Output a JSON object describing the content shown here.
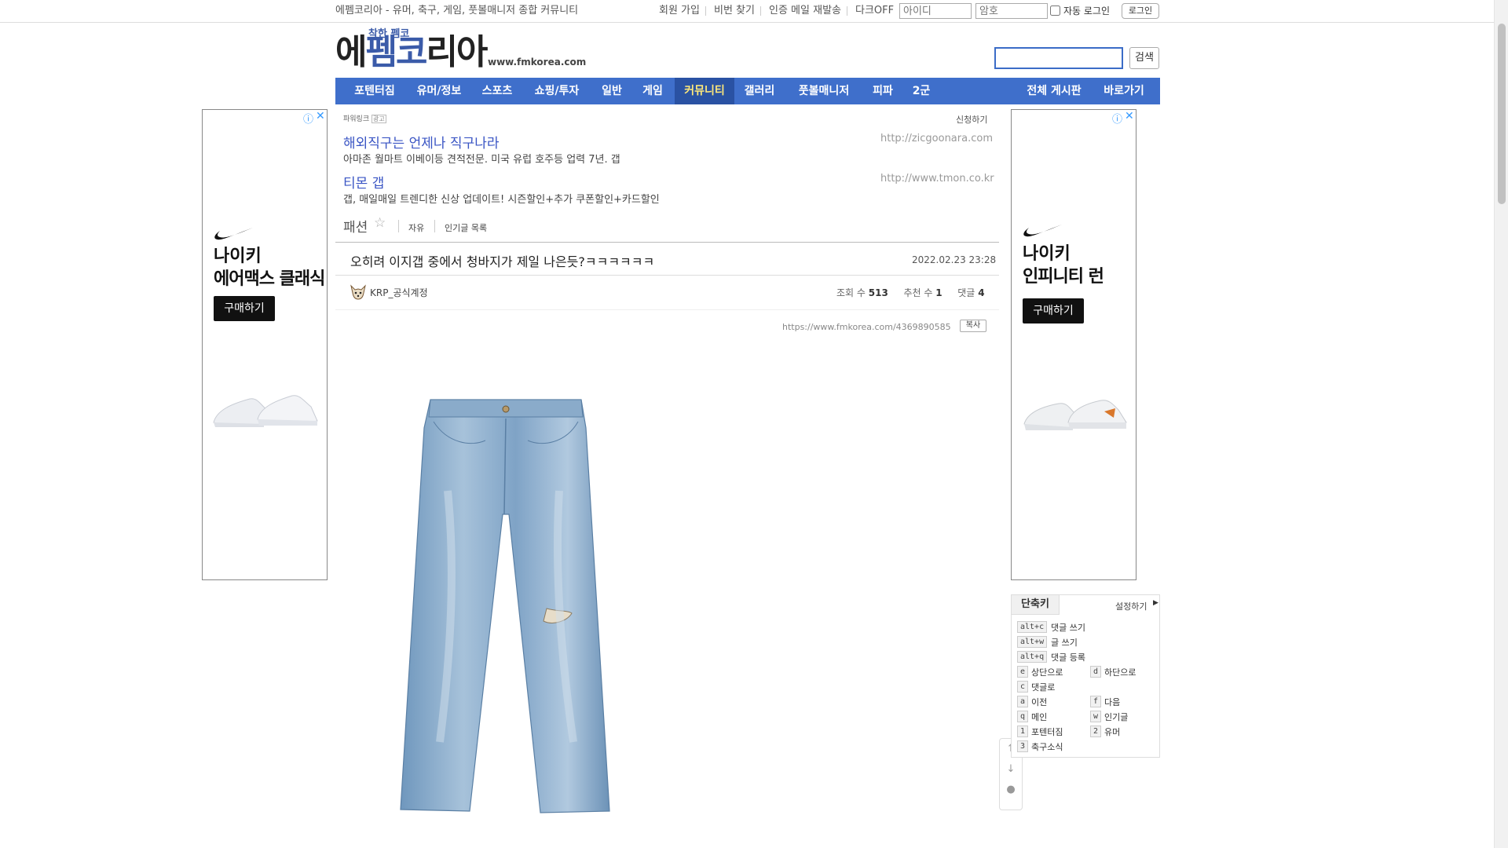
{
  "topbar": {
    "site_desc": "에펨코리아 - 유머, 축구, 게임, 풋볼매니저 종합 커뮤니티",
    "links": [
      "회원 가입",
      "비번 찾기",
      "인증 메일 재발송",
      "다크OFF"
    ],
    "id_placeholder": "아이디",
    "pw_placeholder": "암호",
    "auto_login": "자동 로그인",
    "login": "로그인"
  },
  "logo": {
    "tagline": "착한 펨코",
    "main_left": "에",
    "main_blue": "펨코",
    "main_right": "리아",
    "url": "www.fmkorea.com"
  },
  "search": {
    "button": "검색"
  },
  "nav": {
    "items": [
      "포텐터짐",
      "유머/정보",
      "스포츠",
      "쇼핑/투자",
      "일반",
      "게임",
      "커뮤니티",
      "갤러리",
      "풋볼매니저",
      "피파",
      "2군"
    ],
    "active_index": 6,
    "right": [
      "전체 게시판",
      "바로가기"
    ],
    "color": "#3f6fcb",
    "active_color": "#2a52a3"
  },
  "left_ad": {
    "line1": "나이키",
    "line2": "에어맥스 클래식",
    "buy": "구매하기"
  },
  "right_ad": {
    "line1": "나이키",
    "line2": "인피니티 런",
    "buy": "구매하기"
  },
  "powerlink": {
    "label": "파워링크",
    "badge": "광고",
    "apply": "신청하기",
    "ads": [
      {
        "title": "해외직구는 언제나 직구나라",
        "desc": "아마존 월마트 이베이등 견적전문. 미국 유럽 호주등 업력 7년. 갭",
        "url": "http://zicgoonara.com"
      },
      {
        "title": "티몬 갭",
        "desc": "갭, 매일매일 트렌디한 신상 업데이트! 시즌할인+추가 쿠폰할인+카드할인",
        "url": "http://www.tmon.co.kr"
      }
    ]
  },
  "board": {
    "name": "패션",
    "star": "☆",
    "links": [
      "자유",
      "인기글 목록"
    ]
  },
  "post": {
    "title": "오히려 이지갭 중에서 청바지가 제일 나은듯?ㅋㅋㅋㅋㅋㅋ",
    "date": "2022.02.23 23:28",
    "author": "KRP_공식계정",
    "views_label": "조회 수",
    "views": "513",
    "recommend_label": "추천 수",
    "recommend": "1",
    "comments_label": "댓글",
    "comments": "4",
    "url": "https://www.fmkorea.com/4369890585",
    "copy": "복사"
  },
  "shortcuts": {
    "title": "단축키",
    "settings": "설정하기",
    "items": [
      {
        "key": "alt+c",
        "label": "댓글 쓰기"
      },
      {
        "key": "alt+w",
        "label": "글 쓰기"
      },
      {
        "key": "alt+q",
        "label": "댓글 등록"
      },
      {
        "key": "e",
        "label": "상단으로"
      },
      {
        "key": "d",
        "label": "하단으로"
      },
      {
        "key": "c",
        "label": "댓글로"
      },
      {
        "key": "a",
        "label": "이전"
      },
      {
        "key": "f",
        "label": "다음"
      },
      {
        "key": "q",
        "label": "메인"
      },
      {
        "key": "w",
        "label": "인기글"
      },
      {
        "key": "1",
        "label": "포텐터짐"
      },
      {
        "key": "2",
        "label": "유머"
      },
      {
        "key": "3",
        "label": "축구소식"
      }
    ]
  },
  "icons": {
    "arrow_up": "arrow-up-icon",
    "arrow_down": "arrow-down-icon",
    "comment": "comment-icon",
    "info": "info-icon",
    "close": "close-icon"
  }
}
